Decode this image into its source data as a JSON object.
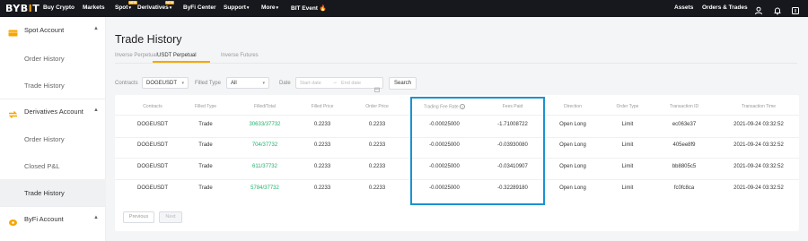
{
  "nav": {
    "logo_a": "BYB",
    "logo_b": "I",
    "logo_c": "T",
    "items": [
      "Buy Crypto",
      "Markets",
      "Spot",
      "Derivatives",
      "ByFi Center",
      "Support",
      "More",
      "BIT Event"
    ],
    "badges": {
      "spot": "NEW",
      "derivatives": "NEW"
    },
    "right": {
      "assets": "Assets",
      "orders": "Orders & Trades"
    }
  },
  "sidebar": {
    "sections": [
      {
        "label": "Spot Account",
        "links": [
          "Order History",
          "Trade History"
        ]
      },
      {
        "label": "Derivatives Account",
        "links": [
          "Order History",
          "Closed P&L",
          "Trade History"
        ]
      },
      {
        "label": "ByFi Account",
        "links": []
      }
    ],
    "active": "Derivatives Account / Trade History"
  },
  "main": {
    "title": "Trade History",
    "tabs": [
      "Inverse Perpetual",
      "USDT Perpetual",
      "Inverse Futures"
    ],
    "active_tab": "USDT Perpetual",
    "filters": {
      "contracts_label": "Contracts",
      "contracts_value": "DOGEUSDT",
      "filled_type_label": "Filled Type",
      "filled_type_value": "All",
      "date_label": "Date",
      "start_placeholder": "Start date",
      "end_placeholder": "End date",
      "search_label": "Search"
    },
    "table": {
      "headers": [
        "Contracts",
        "Filled Type",
        "Filled/Total",
        "Filled Price",
        "Order Price",
        "Trading Fee Rate",
        "Fees Paid",
        "Direction",
        "Order Type",
        "Transaction ID",
        "Transaction Time"
      ],
      "rows": [
        [
          "DOGEUSDT",
          "Trade",
          "30633/37732",
          "0.2233",
          "0.2233",
          "-0.00025000",
          "-1.71008722",
          "Open Long",
          "Limit",
          "ec063e37",
          "2021-09-24 03:32:52"
        ],
        [
          "DOGEUSDT",
          "Trade",
          "704/37732",
          "0.2233",
          "0.2233",
          "-0.00025000",
          "-0.03930080",
          "Open Long",
          "Limit",
          "405ee8f9",
          "2021-09-24 03:32:52"
        ],
        [
          "DOGEUSDT",
          "Trade",
          "611/37732",
          "0.2233",
          "0.2233",
          "-0.00025000",
          "-0.03410907",
          "Open Long",
          "Limit",
          "bb8805c5",
          "2021-09-24 03:32:52"
        ],
        [
          "DOGEUSDT",
          "Trade",
          "5784/37732",
          "0.2233",
          "0.2233",
          "-0.00025000",
          "-0.32289180",
          "Open Long",
          "Limit",
          "fc0fc8ca",
          "2021-09-24 03:32:52"
        ]
      ]
    },
    "pagination": {
      "previous": "Previous",
      "next": "Next"
    }
  },
  "colors": {
    "accent": "#f7a600",
    "green": "#20b26c",
    "highlight": "#1a93d0",
    "nav_bg": "#17181e"
  }
}
